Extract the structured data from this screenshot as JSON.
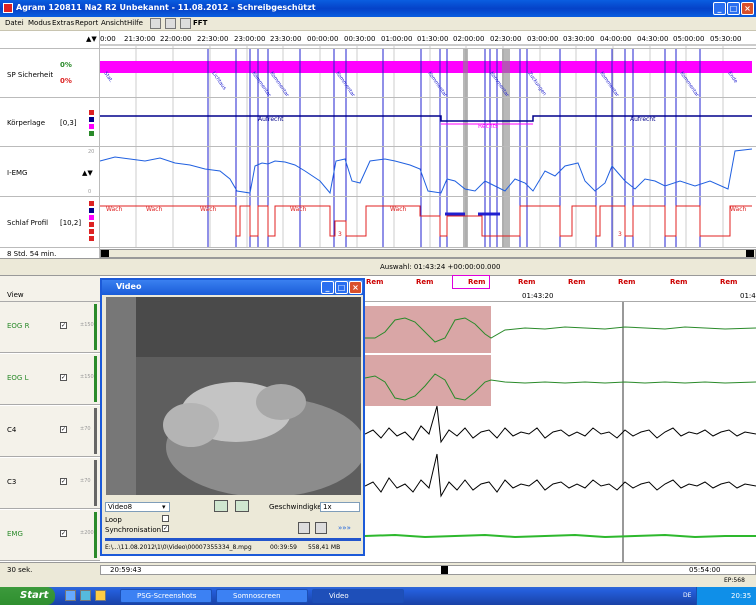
{
  "window": {
    "title": "Agram 120811 Na2 R2 Unbekannt - 11.08.2012 - Schreibgeschützt"
  },
  "menu": [
    "Datei",
    "Modus",
    "Extras",
    "Report",
    "Ansicht",
    "Hilfe"
  ],
  "toolbar": {
    "fft_label": "FFT"
  },
  "timeline": {
    "arrows": "▲▼",
    "ticks": [
      "0:00",
      "21:30:00",
      "22:00:00",
      "22:30:00",
      "23:00:00",
      "23:30:00",
      "00:00:00",
      "00:30:00",
      "01:00:00",
      "01:30:00",
      "02:00:00",
      "02:30:00",
      "03:00:00",
      "03:30:00",
      "04:00:00",
      "04:30:00",
      "05:00:00",
      "05:30:00"
    ]
  },
  "rows": {
    "sp": {
      "label": "SP Sicherheit",
      "pct1": "0%",
      "pct2": "0%"
    },
    "koerper": {
      "label": "Körperlage",
      "range": "[0,3]",
      "a1": "Aufrecht",
      "a2": "Rechts",
      "a3": "Aufrecht"
    },
    "emg": {
      "label": "I-EMG",
      "arrows": "▲▼",
      "scale_top": "20",
      "scale_bot": "0"
    },
    "schlaf": {
      "label": "Schlaf Profil",
      "range": "[10,2]",
      "stages": [
        "Wach",
        "Wach",
        "Wach",
        "Wach",
        "Wach",
        "3",
        "3",
        "Wach"
      ]
    }
  },
  "overview": {
    "duration": "8 Std. 54 min.",
    "selection": "Auswahl: 01:43:24  +00:00:00.000"
  },
  "epochs": {
    "labels": [
      "Rem",
      "Rem",
      "Rem",
      "Rem",
      "Rem",
      "Rem",
      "Rem",
      "Rem"
    ],
    "time": "01:43:20",
    "time2": "01:4"
  },
  "channels": [
    {
      "name": "EOG R",
      "scale": "±150",
      "color": "#2a8a2a"
    },
    {
      "name": "EOG L",
      "scale": "±150",
      "color": "#2a8a2a"
    },
    {
      "name": "C4",
      "scale": "±70",
      "color": "#000000"
    },
    {
      "name": "C3",
      "scale": "±70",
      "color": "#000000"
    },
    {
      "name": "EMG",
      "scale": "±200",
      "color": "#2a8a2a"
    }
  ],
  "view_label": "View",
  "video": {
    "title": "Video",
    "device": "Video8",
    "speed_label": "Geschwindigkeit",
    "speed": "1x",
    "loop_label": "Loop",
    "sync_label": "Synchronisation",
    "file": "E:\\...\\11.08.2012\\1\\0\\Video\\00007355334_8.mpg",
    "time": "00:39:59",
    "size": "558,41 MB"
  },
  "bottom": {
    "sec": "30 sek.",
    "start": "20:59:43",
    "end": "05:54:00",
    "ep": "EP:568"
  },
  "taskbar": {
    "start": "Start",
    "tasks": [
      "PSG-Screenshots",
      "Somnoscreen",
      "Video"
    ],
    "lang": "DE",
    "clock": "20:35"
  },
  "colors": {
    "accent": "#ff00ff",
    "title": "#0542c8"
  }
}
